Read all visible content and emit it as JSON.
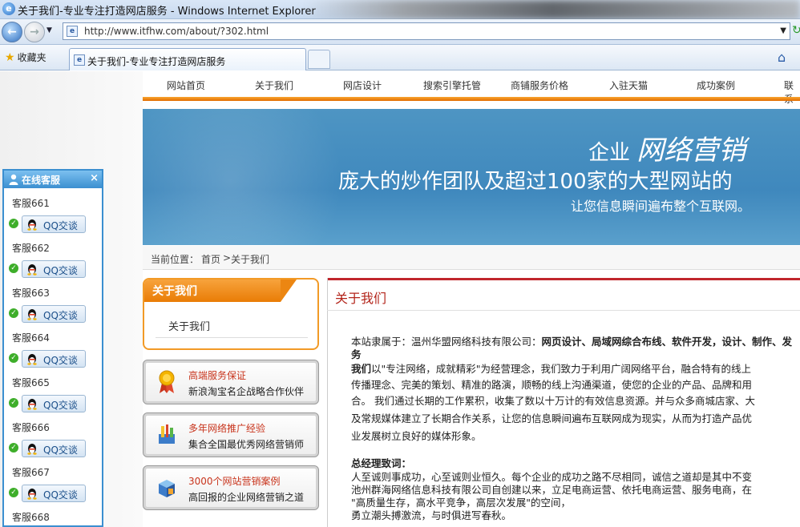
{
  "window": {
    "title": "关于我们-专业专注打造网店服务 - Windows Internet Explorer"
  },
  "address": {
    "url": "http://www.itfhw.com/about/?302.html"
  },
  "favorites": {
    "label": "收藏夹"
  },
  "tab": {
    "label": "关于我们-专业专注打造网店服务"
  },
  "nav": {
    "items": [
      "网站首页",
      "关于我们",
      "网店设计",
      "搜索引擎托管",
      "商铺服务价格",
      "入驻天猫",
      "成功案例",
      "联系"
    ]
  },
  "banner": {
    "line1a": "企业",
    "line1b": "网络营销",
    "line2": "庞大的炒作团队及超过100家的大型网站的",
    "line3": "让您信息瞬间遍布整个互联网。"
  },
  "breadcrumb": {
    "label": "当前位置：",
    "home": "首页",
    "sep": ">",
    "current": "关于我们"
  },
  "sidebar": {
    "box_title": "关于我们",
    "box_item": "关于我们",
    "features": [
      {
        "title": "高端服务保证",
        "sub": "新浪淘宝名企战略合作伙伴"
      },
      {
        "title": "多年网络推广经验",
        "sub": "集合全国最优秀网络营销师"
      },
      {
        "title": "3000个网站营销案例",
        "sub": "高回报的企业网络营销之道"
      }
    ]
  },
  "content": {
    "title": "关于我们",
    "p1_normal": "本站隶属于：温州华盟网络科技有限公司：",
    "p1_bold": "网页设计、局域网综合布线、软件开发，设计、制作、发",
    "p1_cont": "务",
    "p2_bold": "我们",
    "p2_l1": "以\"专注网络，成就精彩\"为经营理念，我们致力于利用广阔网络平台，融合特有的线上",
    "p2_l2": "传播理念、完美的策划、精准的路演，顺畅的线上沟通渠道，使您的企业的产品、品牌和用",
    "p2_l3": "合。  我们通过长期的工作累积，收集了数以十万计的有效信息资源。并与众多商城店家、大",
    "p2_l4": "及常规媒体建立了长期合作关系，让您的信息瞬间遍布互联网成为现实，从而为打造产品优",
    "p2_l5": "业发展树立良好的媒体形象。",
    "gm_title": "总经理致词：",
    "gm_l1": "人至诚则事成功，心至诚则业恒久。每个企业的成功之路不尽相同，诚信之道却是其中不变",
    "gm_l2": "池州群海网络信息科技有限公司自创建以来，立足电商运营、依托电商运营、服务电商，在",
    "gm_l3": "\"高质量生存，高水平竞争，高层次发展\"的空间，",
    "gm_l4": "勇立潮头搏激流，与时俱进写春秋。"
  },
  "service": {
    "title": "在线客服",
    "close": "×",
    "qq_label": "QQ交谈",
    "agents": [
      "客服661",
      "客服662",
      "客服663",
      "客服664",
      "客服665",
      "客服666",
      "客服667",
      "客服668"
    ]
  },
  "colors": {
    "accent_orange": "#f29a26",
    "banner_blue": "#4591c2",
    "title_red": "#b3251b",
    "service_blue": "#3b8fd0"
  }
}
